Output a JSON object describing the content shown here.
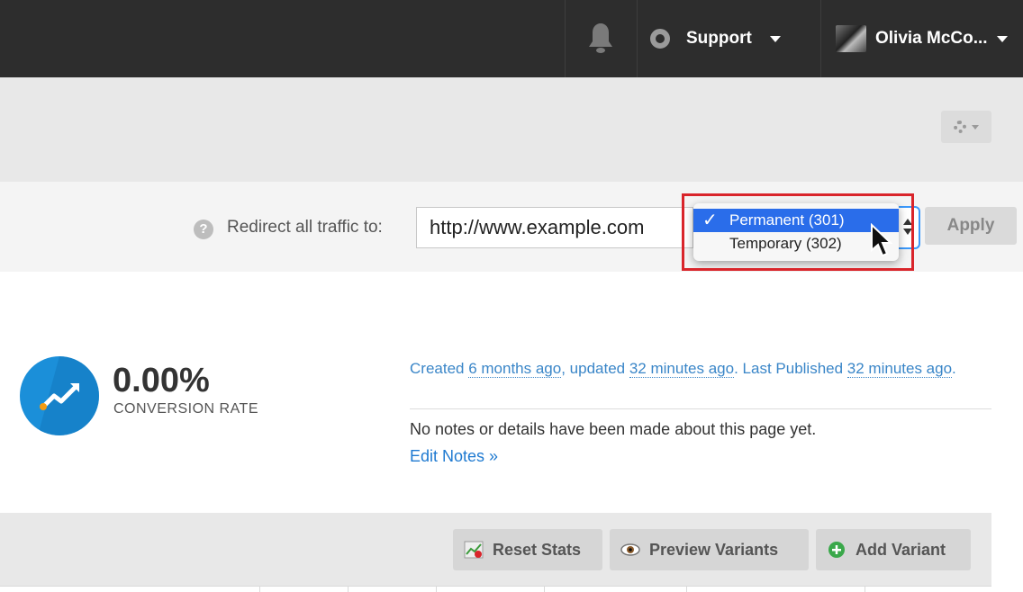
{
  "topbar": {
    "support_label": "Support",
    "user_name": "Olivia McCo..."
  },
  "redirect": {
    "label": "Redirect all traffic to:",
    "help_glyph": "?",
    "url_value": "http://www.example.com",
    "apply_label": "Apply",
    "options": [
      {
        "label": "Permanent (301)",
        "selected": true
      },
      {
        "label": "Temporary (302)",
        "selected": false
      }
    ],
    "check_glyph": "✓"
  },
  "stats": {
    "conversion_rate": "0.00%",
    "conversion_label": "CONVERSION RATE"
  },
  "meta": {
    "created_prefix": "Created ",
    "created_ago": "6 months ago",
    "updated_prefix": ", updated ",
    "updated_ago": "32 minutes ago",
    "published_prefix": ". Last Published ",
    "published_ago": "32 minutes ago",
    "suffix": ".",
    "notes": "No notes or details have been made about this page yet.",
    "edit_notes": "Edit Notes »"
  },
  "variants_toolbar": {
    "reset_label": "Reset Stats",
    "preview_label": "Preview Variants",
    "add_label": "Add Variant"
  },
  "colors": {
    "topbar": "#2d2d2d",
    "accent_blue": "#1b8fd9",
    "link_blue": "#3a86c8",
    "select_highlight": "#2a6dea",
    "annotation_red": "#d9252b"
  }
}
